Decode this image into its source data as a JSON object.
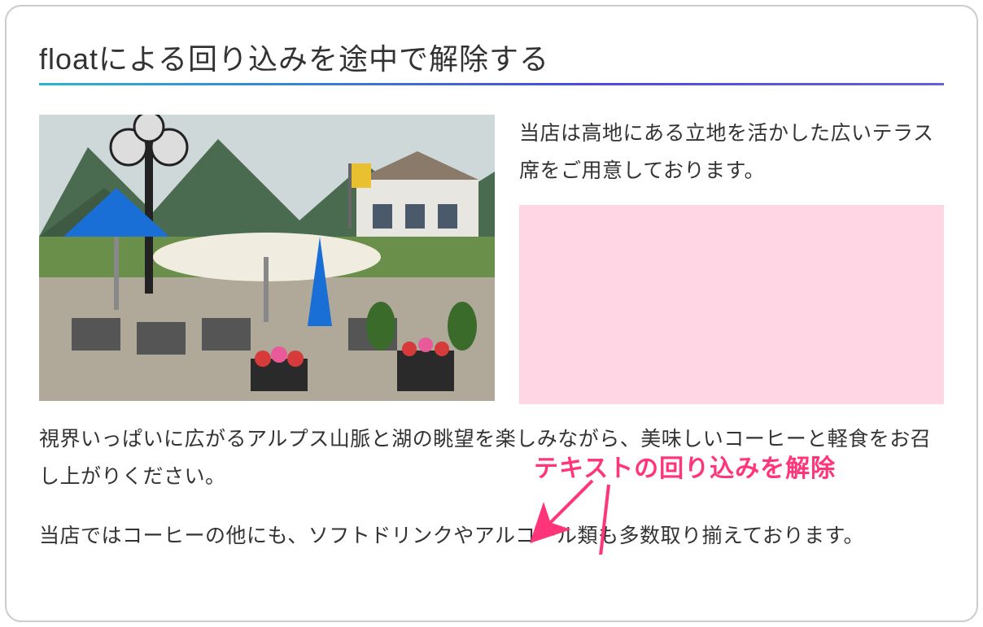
{
  "heading": "floatによる回り込みを途中で解除する",
  "paragraphs": {
    "p1": "当店は高地にある立地を活かした広いテラス席をご用意しております。",
    "p2": "視界いっぱいに広がるアルプス山脈と湖の眺望を楽しみながら、美味しいコーヒーと軽食をお召し上がりください。",
    "p3": "当店ではコーヒーの他にも、ソフトドリンクやアルコール類も多数取り揃えております。"
  },
  "annotation": "テキストの回り込みを解除",
  "imageAlt": "alpine-terrace-cafe-photo"
}
